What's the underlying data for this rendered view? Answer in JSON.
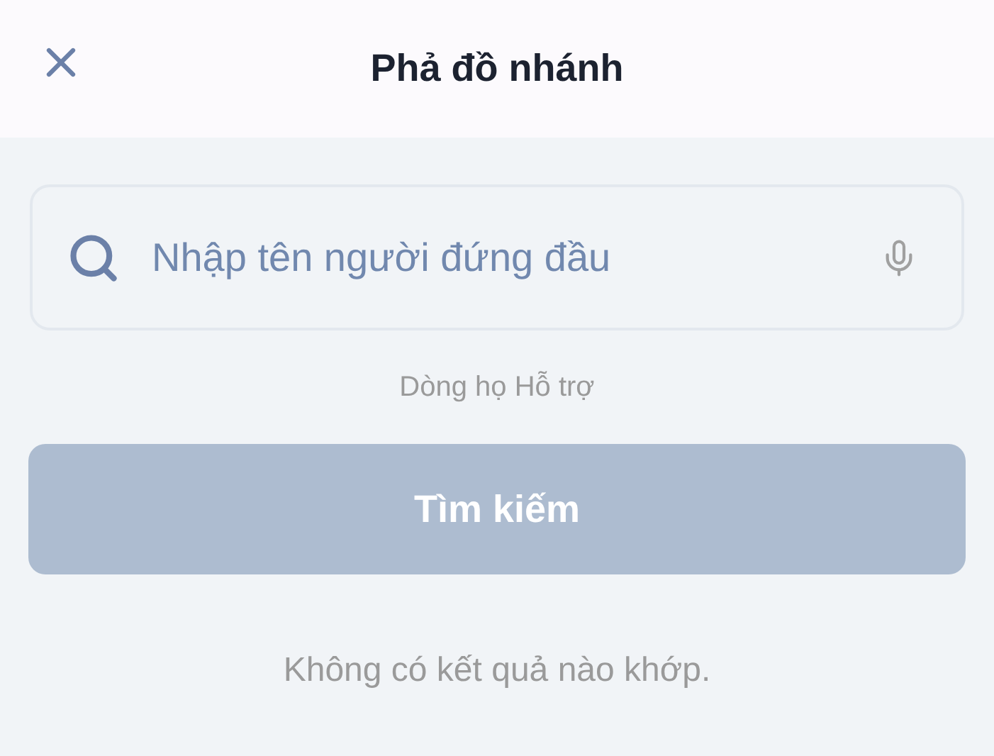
{
  "header": {
    "title": "Phả đồ nhánh"
  },
  "search": {
    "placeholder": "Nhập tên người đứng đầu"
  },
  "hint": "Dòng họ Hỗ trợ",
  "search_button": {
    "label": "Tìm kiếm",
    "disabled": true
  },
  "empty_message": "Không có kết quả nào khớp."
}
